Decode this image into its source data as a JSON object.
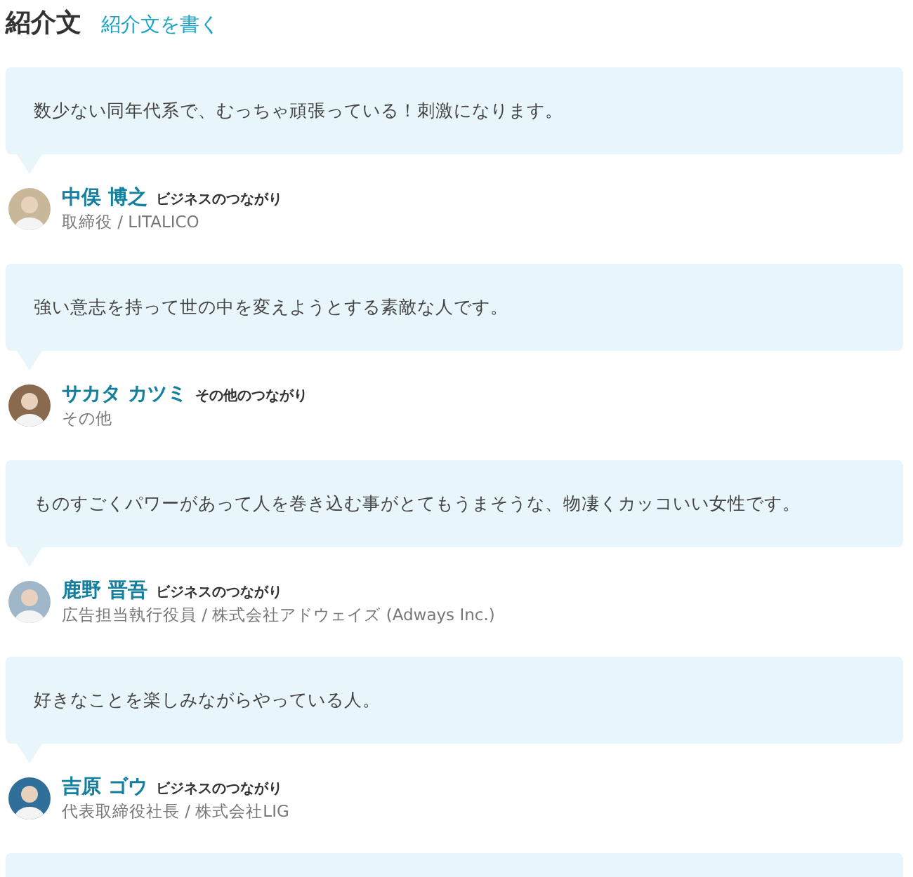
{
  "header": {
    "title": "紹介文",
    "write_link": "紹介文を書く"
  },
  "testimonials": [
    {
      "text": "数少ない同年代系で、むっちゃ頑張っている！刺激になります。",
      "name": "中俣 博之",
      "relation": "ビジネスのつながり",
      "role": "取締役 / LITALICO"
    },
    {
      "text": "強い意志を持って世の中を変えようとする素敵な人です。",
      "name": "サカタ カツミ",
      "relation": "その他のつながり",
      "role": "その他"
    },
    {
      "text": "ものすごくパワーがあって人を巻き込む事がとてもうまそうな、物凄くカッコいい女性です。",
      "name": "鹿野 晋吾",
      "relation": "ビジネスのつながり",
      "role": "広告担当執行役員 / 株式会社アドウェイズ (Adways Inc.)"
    },
    {
      "text": "好きなことを楽しみながらやっている人。",
      "name": "吉原 ゴウ",
      "relation": "ビジネスのつながり",
      "role": "代表取締役社長 / 株式会社LIG"
    }
  ],
  "partial_bubble": {
    "kind": "cut"
  }
}
